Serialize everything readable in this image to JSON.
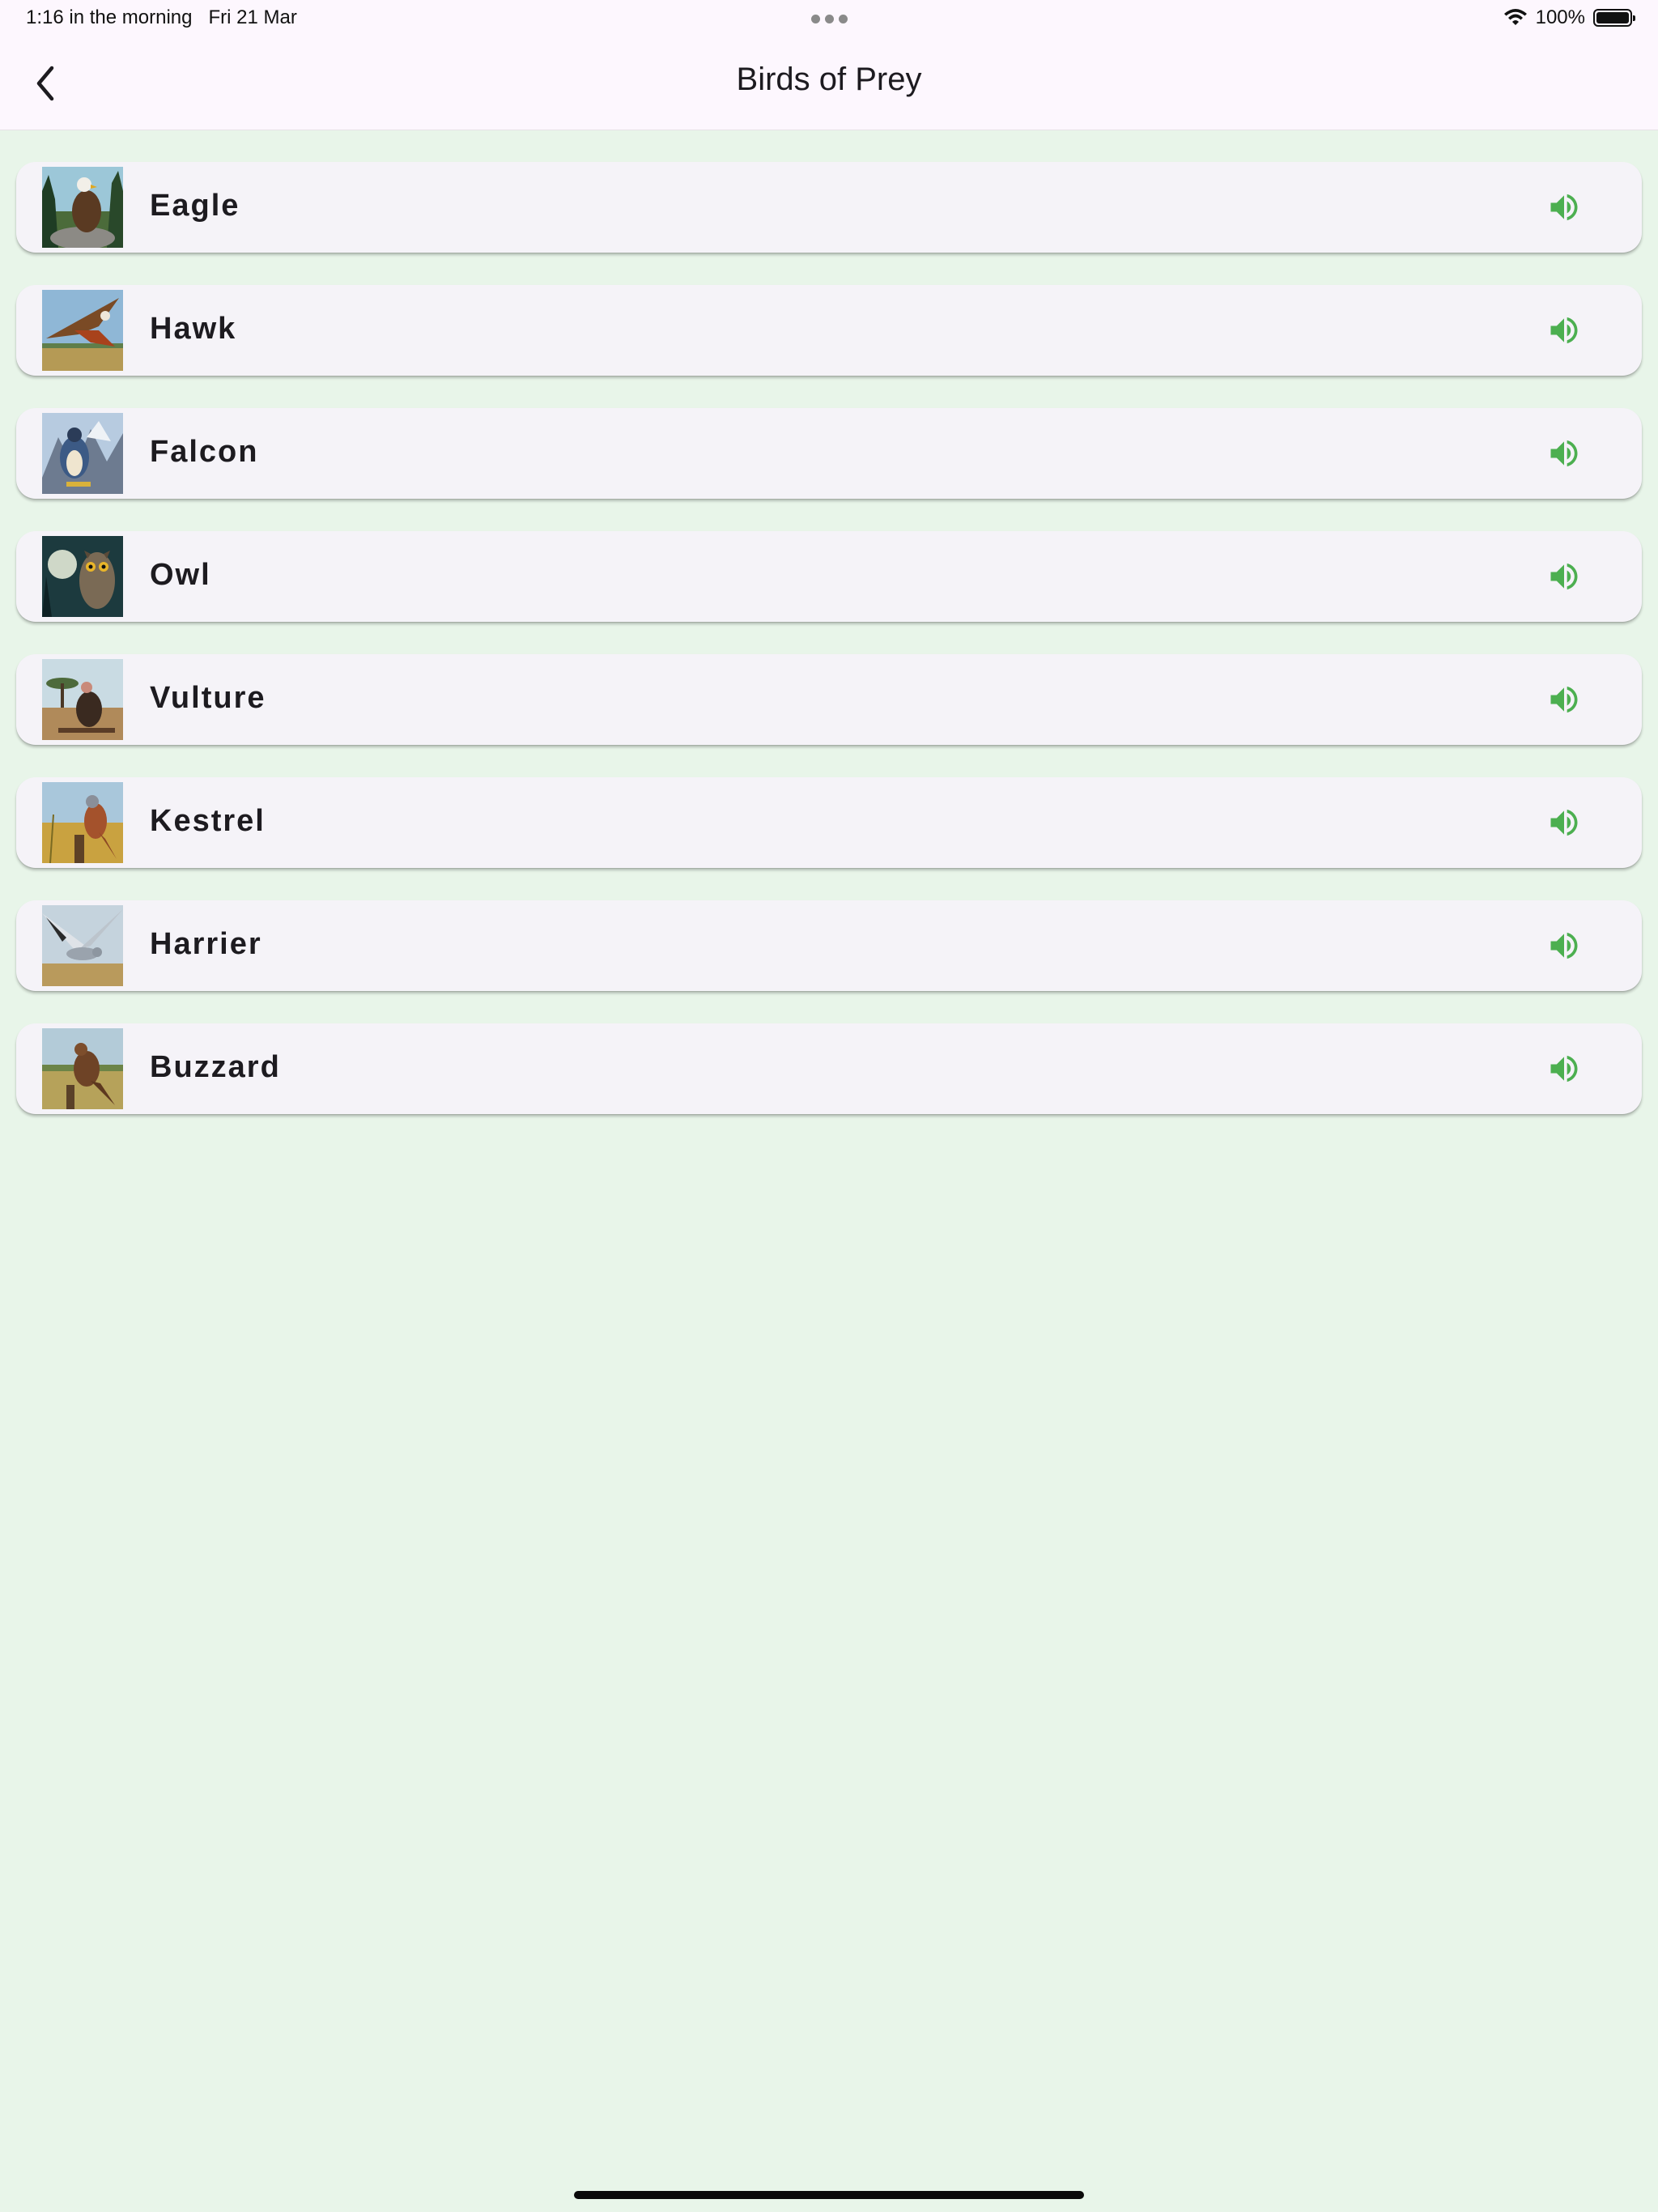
{
  "status_bar": {
    "time": "1:16 in the morning",
    "date": "Fri 21 Mar",
    "battery": "100%"
  },
  "header": {
    "title": "Birds of Prey",
    "back_icon": "chevron-left-icon"
  },
  "colors": {
    "background": "#e8f5e9",
    "app_bar": "#fdf7fe",
    "card": "#f5f3f8",
    "sound_icon": "#4caf50"
  },
  "birds": [
    {
      "name": "Eagle",
      "icon": "volume-up-icon"
    },
    {
      "name": "Hawk",
      "icon": "volume-up-icon"
    },
    {
      "name": "Falcon",
      "icon": "volume-up-icon"
    },
    {
      "name": "Owl",
      "icon": "volume-up-icon"
    },
    {
      "name": "Vulture",
      "icon": "volume-up-icon"
    },
    {
      "name": "Kestrel",
      "icon": "volume-up-icon"
    },
    {
      "name": "Harrier",
      "icon": "volume-up-icon"
    },
    {
      "name": "Buzzard",
      "icon": "volume-up-icon"
    }
  ]
}
